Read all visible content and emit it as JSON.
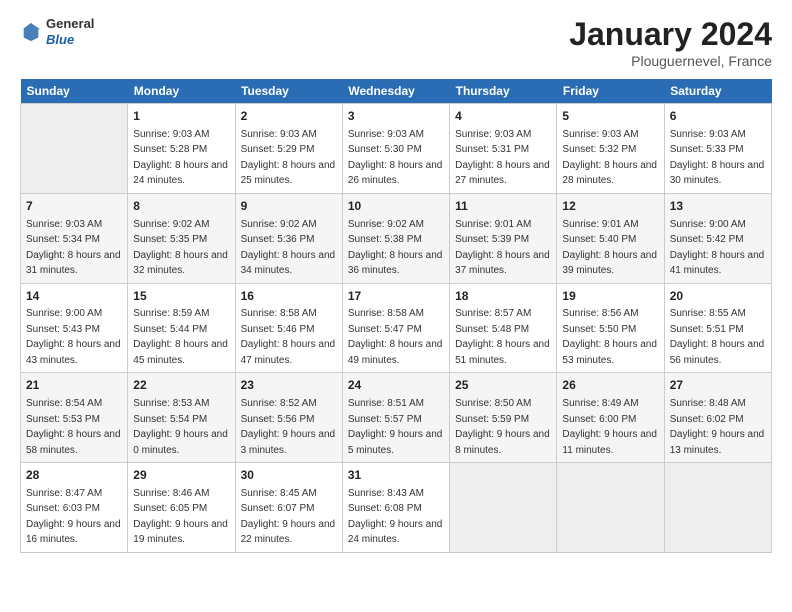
{
  "header": {
    "logo_general": "General",
    "logo_blue": "Blue",
    "title": "January 2024",
    "location": "Plouguernevel, France"
  },
  "calendar": {
    "days_of_week": [
      "Sunday",
      "Monday",
      "Tuesday",
      "Wednesday",
      "Thursday",
      "Friday",
      "Saturday"
    ],
    "weeks": [
      [
        {
          "num": "",
          "empty": true
        },
        {
          "num": "1",
          "sunrise": "9:03 AM",
          "sunset": "5:28 PM",
          "daylight": "8 hours and 24 minutes."
        },
        {
          "num": "2",
          "sunrise": "9:03 AM",
          "sunset": "5:29 PM",
          "daylight": "8 hours and 25 minutes."
        },
        {
          "num": "3",
          "sunrise": "9:03 AM",
          "sunset": "5:30 PM",
          "daylight": "8 hours and 26 minutes."
        },
        {
          "num": "4",
          "sunrise": "9:03 AM",
          "sunset": "5:31 PM",
          "daylight": "8 hours and 27 minutes."
        },
        {
          "num": "5",
          "sunrise": "9:03 AM",
          "sunset": "5:32 PM",
          "daylight": "8 hours and 28 minutes."
        },
        {
          "num": "6",
          "sunrise": "9:03 AM",
          "sunset": "5:33 PM",
          "daylight": "8 hours and 30 minutes."
        }
      ],
      [
        {
          "num": "7",
          "sunrise": "9:03 AM",
          "sunset": "5:34 PM",
          "daylight": "8 hours and 31 minutes."
        },
        {
          "num": "8",
          "sunrise": "9:02 AM",
          "sunset": "5:35 PM",
          "daylight": "8 hours and 32 minutes."
        },
        {
          "num": "9",
          "sunrise": "9:02 AM",
          "sunset": "5:36 PM",
          "daylight": "8 hours and 34 minutes."
        },
        {
          "num": "10",
          "sunrise": "9:02 AM",
          "sunset": "5:38 PM",
          "daylight": "8 hours and 36 minutes."
        },
        {
          "num": "11",
          "sunrise": "9:01 AM",
          "sunset": "5:39 PM",
          "daylight": "8 hours and 37 minutes."
        },
        {
          "num": "12",
          "sunrise": "9:01 AM",
          "sunset": "5:40 PM",
          "daylight": "8 hours and 39 minutes."
        },
        {
          "num": "13",
          "sunrise": "9:00 AM",
          "sunset": "5:42 PM",
          "daylight": "8 hours and 41 minutes."
        }
      ],
      [
        {
          "num": "14",
          "sunrise": "9:00 AM",
          "sunset": "5:43 PM",
          "daylight": "8 hours and 43 minutes."
        },
        {
          "num": "15",
          "sunrise": "8:59 AM",
          "sunset": "5:44 PM",
          "daylight": "8 hours and 45 minutes."
        },
        {
          "num": "16",
          "sunrise": "8:58 AM",
          "sunset": "5:46 PM",
          "daylight": "8 hours and 47 minutes."
        },
        {
          "num": "17",
          "sunrise": "8:58 AM",
          "sunset": "5:47 PM",
          "daylight": "8 hours and 49 minutes."
        },
        {
          "num": "18",
          "sunrise": "8:57 AM",
          "sunset": "5:48 PM",
          "daylight": "8 hours and 51 minutes."
        },
        {
          "num": "19",
          "sunrise": "8:56 AM",
          "sunset": "5:50 PM",
          "daylight": "8 hours and 53 minutes."
        },
        {
          "num": "20",
          "sunrise": "8:55 AM",
          "sunset": "5:51 PM",
          "daylight": "8 hours and 56 minutes."
        }
      ],
      [
        {
          "num": "21",
          "sunrise": "8:54 AM",
          "sunset": "5:53 PM",
          "daylight": "8 hours and 58 minutes."
        },
        {
          "num": "22",
          "sunrise": "8:53 AM",
          "sunset": "5:54 PM",
          "daylight": "9 hours and 0 minutes."
        },
        {
          "num": "23",
          "sunrise": "8:52 AM",
          "sunset": "5:56 PM",
          "daylight": "9 hours and 3 minutes."
        },
        {
          "num": "24",
          "sunrise": "8:51 AM",
          "sunset": "5:57 PM",
          "daylight": "9 hours and 5 minutes."
        },
        {
          "num": "25",
          "sunrise": "8:50 AM",
          "sunset": "5:59 PM",
          "daylight": "9 hours and 8 minutes."
        },
        {
          "num": "26",
          "sunrise": "8:49 AM",
          "sunset": "6:00 PM",
          "daylight": "9 hours and 11 minutes."
        },
        {
          "num": "27",
          "sunrise": "8:48 AM",
          "sunset": "6:02 PM",
          "daylight": "9 hours and 13 minutes."
        }
      ],
      [
        {
          "num": "28",
          "sunrise": "8:47 AM",
          "sunset": "6:03 PM",
          "daylight": "9 hours and 16 minutes."
        },
        {
          "num": "29",
          "sunrise": "8:46 AM",
          "sunset": "6:05 PM",
          "daylight": "9 hours and 19 minutes."
        },
        {
          "num": "30",
          "sunrise": "8:45 AM",
          "sunset": "6:07 PM",
          "daylight": "9 hours and 22 minutes."
        },
        {
          "num": "31",
          "sunrise": "8:43 AM",
          "sunset": "6:08 PM",
          "daylight": "9 hours and 24 minutes."
        },
        {
          "num": "",
          "empty": true
        },
        {
          "num": "",
          "empty": true
        },
        {
          "num": "",
          "empty": true
        }
      ]
    ]
  }
}
